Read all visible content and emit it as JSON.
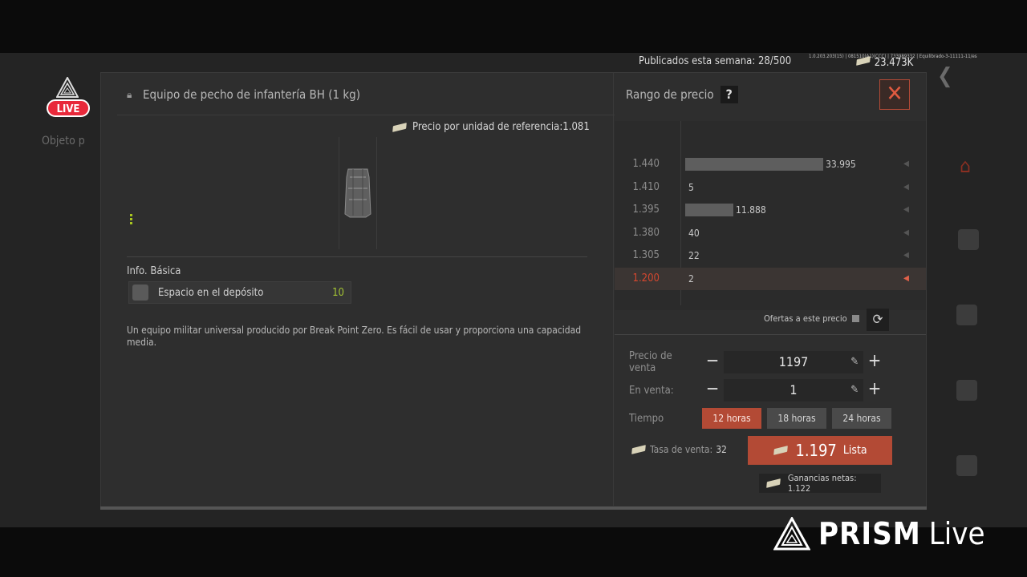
{
  "header": {
    "published_label": "Publicados esta semana: 28/500",
    "debug_text": "1.0.203.203(15) | 081510(A1)(CCC) | 733989332 | Equilibrado-3-11111-11/es",
    "money": "23.473K"
  },
  "background": {
    "left_label": "Objeto p"
  },
  "overlay": {
    "live_badge": "LIVE",
    "prism_brand": "PRISM",
    "prism_live": "Live"
  },
  "item": {
    "title": "Equipo de pecho de infantería BH (1 kg)",
    "ref_price_label": "Precio por unidad de referencia:",
    "ref_price_value": "1.081",
    "info_heading": "Info. Básica",
    "storage_label": "Espacio en el depósito",
    "storage_value": "10",
    "description": "Un equipo militar universal producido por Break Point Zero. Es fácil de usar y proporciona una capacidad media."
  },
  "price_range": {
    "title": "Rango de precio",
    "help": "?",
    "close": "✕",
    "rows": [
      {
        "price": "1.440",
        "count": "33.995",
        "bar": 0.505
      },
      {
        "price": "1.410",
        "count": "5",
        "bar": 0
      },
      {
        "price": "1.395",
        "count": "11.888",
        "bar": 0.177
      },
      {
        "price": "1.380",
        "count": "40",
        "bar": 0
      },
      {
        "price": "1.305",
        "count": "22",
        "bar": 0
      },
      {
        "price": "1.200",
        "count": "2",
        "bar": 0,
        "selected": true
      }
    ],
    "offers_label": "Ofertas a este precio"
  },
  "sell_form": {
    "price_label": "Precio de venta",
    "price_value": "1197",
    "qty_label": "En venta:",
    "qty_value": "1",
    "time_label": "Tiempo",
    "time_options": [
      "12 horas",
      "18 horas",
      "24 horas"
    ],
    "time_selected": 0,
    "fee_label": "Tasa de venta:",
    "fee_value": "32",
    "list_amount": "1.197",
    "list_label": "Lista",
    "net_label": "Ganancias netas: 1.122",
    "minus": "−",
    "plus": "+",
    "edit_glyph": "✎"
  }
}
